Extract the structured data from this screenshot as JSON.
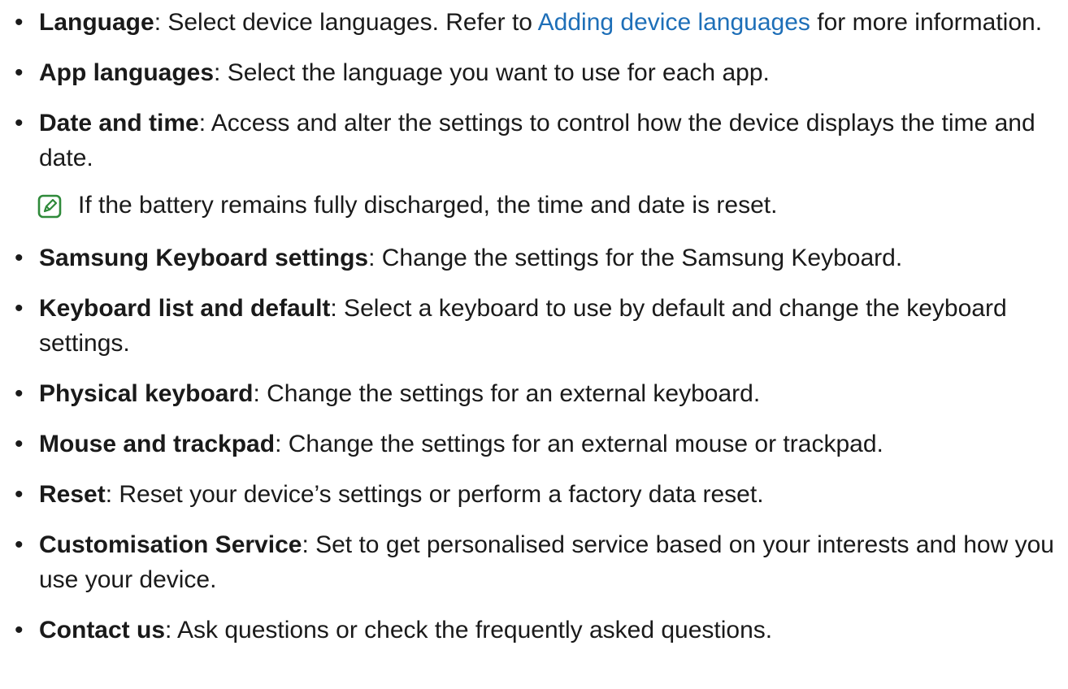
{
  "bullet_glyph": "•",
  "colors": {
    "text": "#1a1a1a",
    "link": "#1e6fb8",
    "note_icon": "#2f8a3a"
  },
  "items": [
    {
      "term": "Language",
      "text_before_link": ": Select device languages. Refer to ",
      "link": "Adding device languages",
      "text_after_link": " for more information."
    },
    {
      "term": "App languages",
      "text": ": Select the language you want to use for each app."
    },
    {
      "term": "Date and time",
      "text": ": Access and alter the settings to control how the device displays the time and date."
    },
    {
      "term": "Samsung Keyboard settings",
      "text": ": Change the settings for the Samsung Keyboard."
    },
    {
      "term": "Keyboard list and default",
      "text": ": Select a keyboard to use by default and change the keyboard settings."
    },
    {
      "term": "Physical keyboard",
      "text": ": Change the settings for an external keyboard."
    },
    {
      "term": "Mouse and trackpad",
      "text": ": Change the settings for an external mouse or trackpad."
    },
    {
      "term": "Reset",
      "text": ": Reset your device’s settings or perform a factory data reset."
    },
    {
      "term": "Customisation Service",
      "text": ": Set to get personalised service based on your interests and how you use your device."
    },
    {
      "term": "Contact us",
      "text": ": Ask questions or check the frequently asked questions."
    }
  ],
  "note": {
    "icon": "note-pencil-icon",
    "text": "If the battery remains fully discharged, the time and date is reset."
  }
}
